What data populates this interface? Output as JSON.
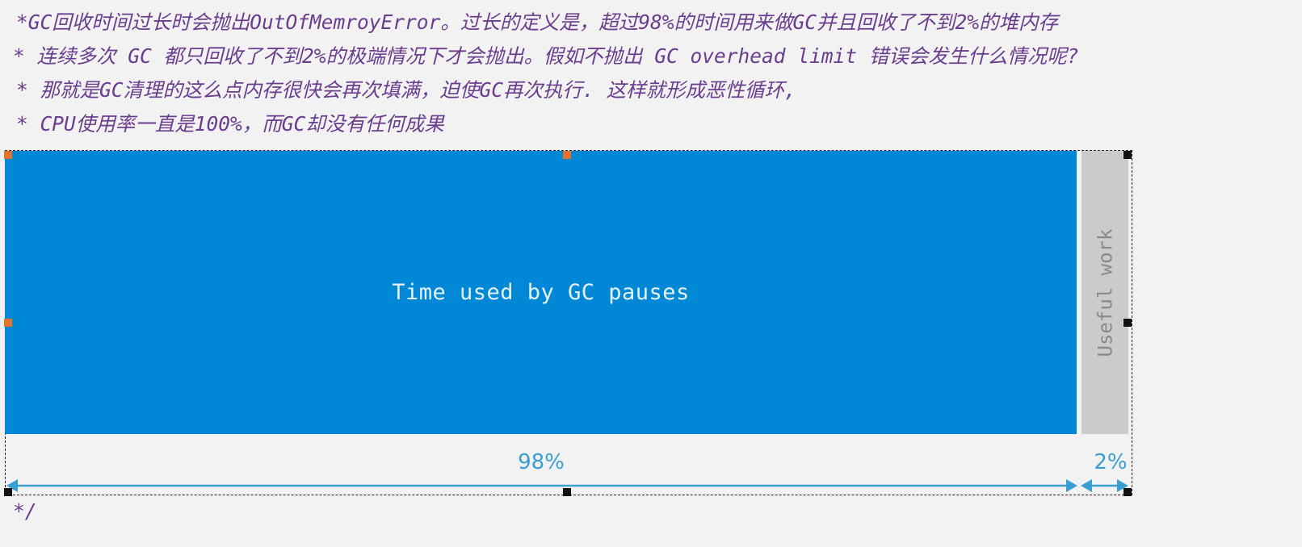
{
  "comment": {
    "lines": [
      "*GC回收时间过长时会抛出OutOfMemroyError。过长的定义是，超过98%的时间用来做GC并且回收了不到2%的堆内存",
      "* 连续多次 GC 都只回收了不到2%的极端情况下才会抛出。假如不抛出 GC overhead limit 错误会发生什么情况呢?",
      "* 那就是GC清理的这么点内存很快会再次填满，迫使GC再次执行. 这样就形成恶性循环,",
      "* CPU使用率一直是100%，而GC却没有任何成果"
    ],
    "end": "*/"
  },
  "diagram": {
    "gc_label": "Time used by GC pauses",
    "work_label": "Useful work",
    "gc_percent_label": "98%",
    "work_percent_label": "2%",
    "gc_fraction": 0.98,
    "work_fraction": 0.02,
    "colors": {
      "gc_block": "#0088d6",
      "work_block": "#cbcbcb",
      "dimension": "#3a9fd0",
      "comment_text": "#6a3d8f",
      "handle_selected": "#e8702a",
      "handle": "#111111"
    }
  }
}
